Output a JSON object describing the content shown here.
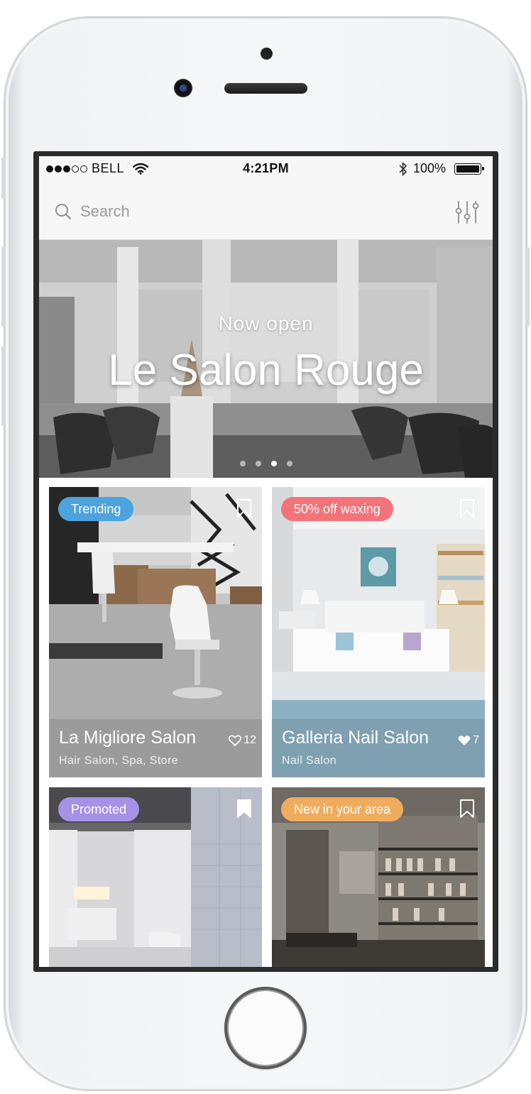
{
  "status_bar": {
    "signal_bars_on": 3,
    "signal_bars_total": 5,
    "carrier": "BELL",
    "time": "4:21PM",
    "battery": "100%",
    "battery_level": 1.0
  },
  "search": {
    "placeholder": "Search",
    "icons": {
      "search": "search-icon",
      "filter": "sliders-icon"
    }
  },
  "hero": {
    "subtitle": "Now open",
    "title": "Le Salon Rouge",
    "carousel_pages": 4,
    "carousel_active_index": 2
  },
  "cards": [
    {
      "badge": "Trending",
      "badge_color": "#4ca3dd",
      "name": "La Migliore Salon",
      "category": "Hair Salon, Spa, Store",
      "likes": "12",
      "liked": false,
      "bookmarked": false,
      "footer_color": "#9b9b9b"
    },
    {
      "badge": "50% off waxing",
      "badge_color": "#f2747a",
      "name": "Galleria Nail Salon",
      "category": "Nail Salon",
      "likes": "7",
      "liked": true,
      "bookmarked": false,
      "footer_color": "#7ea0b1"
    },
    {
      "badge": "Promoted",
      "badge_color": "#a592e6",
      "bookmarked": true
    },
    {
      "badge": "New in your area",
      "badge_color": "#f0ac5e",
      "bookmarked": false
    }
  ]
}
